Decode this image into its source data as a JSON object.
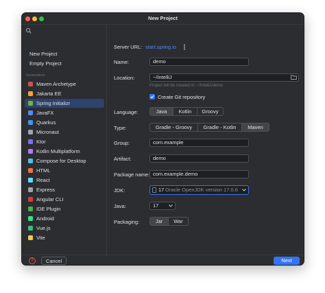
{
  "window": {
    "title": "New Project"
  },
  "sidebar": {
    "search_icon": "search-icon",
    "top_items": [
      {
        "label": "New Project"
      },
      {
        "label": "Empty Project"
      }
    ],
    "generators_label": "Generators",
    "generators": [
      {
        "label": "Maven Archetype",
        "icon": "maven-icon",
        "color": "#c75450"
      },
      {
        "label": "Jakarta EE",
        "icon": "jakarta-icon",
        "color": "#f0a732"
      },
      {
        "label": "Spring Initializr",
        "icon": "spring-icon",
        "color": "#6db33f"
      },
      {
        "label": "JavaFX",
        "icon": "javafx-icon",
        "color": "#548af7"
      },
      {
        "label": "Quarkus",
        "icon": "quarkus-icon",
        "color": "#4695eb"
      },
      {
        "label": "Micronaut",
        "icon": "micronaut-icon",
        "color": "#a0a4aa"
      },
      {
        "label": "Ktor",
        "icon": "ktor-icon",
        "color": "#7f6df2"
      },
      {
        "label": "Kotlin Multiplatform",
        "icon": "kotlin-icon",
        "color": "#b07cf0"
      },
      {
        "label": "Compose for Desktop",
        "icon": "compose-icon",
        "color": "#4fc1e9"
      },
      {
        "label": "HTML",
        "icon": "html-icon",
        "color": "#e8734a"
      },
      {
        "label": "React",
        "icon": "react-icon",
        "color": "#61dafb"
      },
      {
        "label": "Express",
        "icon": "express-icon",
        "color": "#a0a4aa"
      },
      {
        "label": "Angular CLI",
        "icon": "angular-icon",
        "color": "#dd3a3a"
      },
      {
        "label": "IDE Plugin",
        "icon": "plugin-icon",
        "color": "#4caf50"
      },
      {
        "label": "Android",
        "icon": "android-icon",
        "color": "#3ddc84"
      },
      {
        "label": "Vue.js",
        "icon": "vue-icon",
        "color": "#41b883"
      },
      {
        "label": "Vite",
        "icon": "vite-icon",
        "color": "#f2c94c"
      }
    ],
    "selected_index": 2
  },
  "form": {
    "server_url_label": "Server URL:",
    "server_url_value": "start.spring.io",
    "server_menu_icon": "more-vertical-icon",
    "name_label": "Name:",
    "name_value": "demo",
    "location_label": "Location:",
    "location_value": "~/IntelliJ",
    "location_hint": "Project will be created in: ~/IntelliJ/demo",
    "folder_icon": "folder-icon",
    "git_label": "Create Git repository",
    "git_checked": true,
    "language_label": "Language:",
    "languages": [
      "Java",
      "Kotlin",
      "Groovy"
    ],
    "language_selected": 0,
    "type_label": "Type:",
    "types": [
      "Gradle - Groovy",
      "Gradle - Kotlin",
      "Maven"
    ],
    "type_selected": 2,
    "group_label": "Group:",
    "group_value": "com.example",
    "artifact_label": "Artifact:",
    "artifact_value": "demo",
    "package_label": "Package name:",
    "package_value": "com.example.demo",
    "jdk_label": "JDK:",
    "jdk_value": "17",
    "jdk_detail": "Oracle OpenJDK version 17.0.6",
    "java_label": "Java:",
    "java_value": "17",
    "packaging_label": "Packaging:",
    "packagings": [
      "Jar",
      "War"
    ],
    "packaging_selected": 0
  },
  "footer": {
    "help_symbol": "?",
    "cancel_label": "Cancel",
    "next_label": "Next"
  },
  "colors": {
    "accent": "#3574f0",
    "selection": "#2e436e",
    "background": "#2b2d30"
  }
}
